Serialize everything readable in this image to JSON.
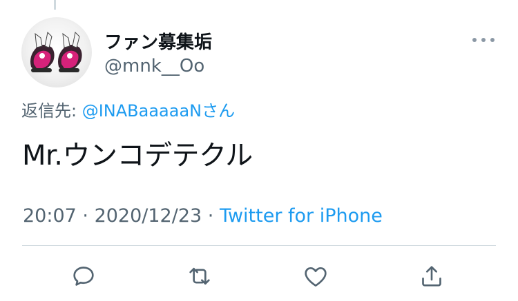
{
  "user": {
    "display_name": "ファン募集垢",
    "handle": "@mnk__Oo"
  },
  "reply": {
    "label": "返信先: ",
    "target": "@INABaaaaaNさん"
  },
  "tweet": {
    "text": "Mr.ウンコデテクル"
  },
  "meta": {
    "time": "20:07",
    "separator": " · ",
    "date": "2020/12/23",
    "source": "Twitter for iPhone"
  },
  "colors": {
    "link": "#1d9bf0",
    "secondary_text": "#536471",
    "icon": "#536471"
  },
  "icons": {
    "more": "more-icon",
    "reply": "reply-icon",
    "retweet": "retweet-icon",
    "like": "like-icon",
    "share": "share-icon"
  }
}
